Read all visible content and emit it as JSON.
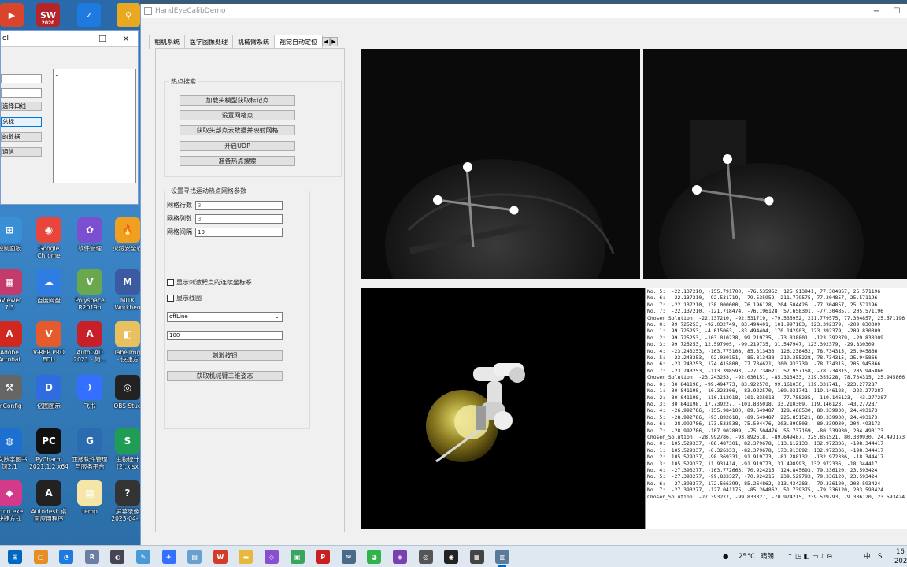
{
  "top_icons": [
    {
      "name": "media-icon",
      "glyph": "▶",
      "color": "#d9452c"
    },
    {
      "name": "solidworks-icon",
      "glyph": "SW",
      "sub": "2020",
      "color": "#b3252a"
    },
    {
      "name": "shield-icon",
      "glyph": "✓",
      "color": "#1f7ae0"
    },
    {
      "name": "search-icon",
      "glyph": "⚲",
      "color": "#e8a820"
    }
  ],
  "small_window": {
    "title": "ol",
    "btn_labels": [
      "选择口线",
      "总标",
      "的数据",
      "通信"
    ],
    "text_value": "1"
  },
  "desktop_icons": [
    {
      "name": "control-panel-icon",
      "label": "控制面板",
      "glyph": "⊞",
      "color": "#3a8fd6"
    },
    {
      "name": "google-chrome-icon",
      "label": "Google\nChrome",
      "glyph": "◉",
      "color": "#e8453c"
    },
    {
      "name": "software-manager-icon",
      "label": "软件管理",
      "glyph": "✿",
      "color": "#7b4fd0"
    },
    {
      "name": "huorong-icon",
      "label": "火绒安全软",
      "glyph": "🔥",
      "color": "#f0a020"
    },
    {
      "name": "gaviewer-icon",
      "label": "aViewer\n7.3",
      "glyph": "▦",
      "color": "#c23b6b"
    },
    {
      "name": "baidu-netdisk-icon",
      "label": "百度网盘",
      "glyph": "☁",
      "color": "#2f7ce3"
    },
    {
      "name": "polyspace-icon",
      "label": "Polyspace\nR2019b",
      "glyph": "V",
      "color": "#6aa84f"
    },
    {
      "name": "mitk-icon",
      "label": "MITK\nWorkben",
      "glyph": "M",
      "color": "#3b5aa0"
    },
    {
      "name": "adobe-acrobat-icon",
      "label": "Adobe\nAcrobat",
      "glyph": "A",
      "color": "#d0281e"
    },
    {
      "name": "vrep-icon",
      "label": "V-REP PRO\nEDU",
      "glyph": "V",
      "color": "#e55b2c"
    },
    {
      "name": "autocad-icon",
      "label": "AutoCAD\n2021 - 简...",
      "glyph": "A",
      "color": "#c8202a"
    },
    {
      "name": "labelimg-icon",
      "label": "labelImg\n- 快捷方",
      "glyph": "◧",
      "color": "#e8c060"
    },
    {
      "name": "cmconfig-icon",
      "label": "mConfig",
      "glyph": "⚒",
      "color": "#666"
    },
    {
      "name": "yitu-icon",
      "label": "亿图图示",
      "glyph": "D",
      "color": "#2f6ce0"
    },
    {
      "name": "feishu-icon",
      "label": "飞书",
      "glyph": "✈",
      "color": "#3370ff"
    },
    {
      "name": "obs-icon",
      "label": "OBS Stud",
      "glyph": "◎",
      "color": "#222"
    },
    {
      "name": "library-icon",
      "label": "图文数字图书\n馆2.1",
      "glyph": "◍",
      "color": "#1d6fd0"
    },
    {
      "name": "pycharm-icon",
      "label": "PyCharm\n2021.1.2 x64",
      "glyph": "PC",
      "color": "#111"
    },
    {
      "name": "cert-assistant-icon",
      "label": "正版软件管理\n与服务平台",
      "glyph": "G",
      "color": "#2b6cb0"
    },
    {
      "name": "excel-file-icon",
      "label": "生物统计\n(2).xlsx",
      "glyph": "S",
      "color": "#1f9d55"
    },
    {
      "name": "micronexe-icon",
      "label": "icron.exe\n快捷方式",
      "glyph": "◆",
      "color": "#d43a8a"
    },
    {
      "name": "autodesk-app-icon",
      "label": "Autodesk 桌\n面应用程序",
      "glyph": "A",
      "color": "#222"
    },
    {
      "name": "temp-folder-icon",
      "label": "temp",
      "glyph": "▤",
      "color": "#f5e6a8"
    },
    {
      "name": "recording-icon",
      "label": "屏幕录像\n2023-04-...",
      "glyph": "?",
      "color": "#333"
    }
  ],
  "main_window": {
    "title": "HandEyeCalibDemo",
    "tabs": [
      "相机系统",
      "医学图像处理",
      "机械臂系统",
      "视觉自动定位"
    ],
    "active_tab": 3,
    "group1": {
      "title": "热点搜索",
      "buttons": [
        "加载头模型获取标记点",
        "设置网格点",
        "获取头部点云数据并映射网格",
        "开启UDP",
        "准备热点搜索"
      ]
    },
    "group2": {
      "title": "设置寻找运动热点网格参数",
      "fields": [
        {
          "label": "网格行数",
          "value": "3"
        },
        {
          "label": "网格列数",
          "value": "3"
        },
        {
          "label": "网格间隔",
          "value": "10"
        }
      ],
      "checkboxes": [
        "显示刺激靶点的连续坐标系",
        "显示线圈"
      ],
      "combo_value": "offLine",
      "input_value": "100",
      "buttons": [
        "刺激按钮",
        "获取机械臂三维姿态"
      ]
    },
    "log_lines": [
      "No. 5:  -22.137210, -155.791700, -76.535952, 125.913941, 77.304857, 25.571196",
      "No. 6:  -22.137210, -92.531719, -79.535952, 211.779575, 77.304857, 25.571196",
      "No. 7:  -22.137210, 138.000000, 76.196128, 204.504426, -77.304857, 25.571196",
      "No. 7:  -22.137210, -121.718474, -76.196128, 57.658301, -77.304857, 205.571196",
      "Chosen_Solution: -22.137210, -92.531719, -79.535952, 211.779575, 77.304857, 25.571196",
      "No. 0:  99.725253, -92.032749, 83.494401, 101.997183, 123.392379, -209.830309",
      "No. 1:  99.725253, -4.015063, -83.494404, 170.142903, 123.392379, -209.830309",
      "No. 2:  99.725253, -103.010238, 99.219735, -73.838801, -123.392379, -29.830309",
      "No. 3:  99.725253, 12.597905, -99.219735, 31.547947, 123.392379, -29.830309",
      "No. 4:  -23.243253, -163.775108, 85.313433, 126.238452, 78.734315, 25.945866",
      "No. 5:  -23.243253, -92.030151, -85.313433, 219.355228, 78.734315, 25.945866",
      "No. 6:  -23.243253, 174.415800, 77.734621, 300.933739, -78.734315, 205.945866",
      "No. 7:  -23.243253, -113.398593, -77.734621, 52.957158, -78.734315, 205.945866",
      "Chosen_Solution: -23.243253, -92.030151, -85.313433, 219.355228, 78.734315, 25.945866",
      "No. 0:  30.841198, -99.494773, 83.922570, 99.161030, 119.331741, -223.277287",
      "No. 1:  30.841198, -10.323306, -83.922570, 169.031741, 119.146123, -223.277287",
      "No. 2:  30.841198, -110.112918, 101.835018, -77.758235, -119.146123, -43.277287",
      "No. 3:  30.841198, 17.739227, -101.835018, 33.210309, 119.146123, -43.277287",
      "No. 4:  -26.992786, -155.984100, 89.649487, 128.466530, 80.339930, 24.493173",
      "No. 5:  -28.992786, -93.892618, -89.649487, 225.851521, 80.339930, 24.493173",
      "No. 6:  -28.992786, 173.533538, 75.504476, 303.399503, -80.339930, 204.493173",
      "No. 7:  -28.992786, -107.902809, -75.504476, 55.737169, -80.339930, 204.493173",
      "Chosen_Solution: -28.992786, -93.892618, -89.649487, 225.851521, 80.339930, 24.493173",
      "No. 0:  105.529337, -88.487301, 82.379678, 113.112133, 132.972336, -198.344417",
      "No. 1:  105.529337, -0.326333, -82.379678, 173.913892, 132.972336, -198.344417",
      "No. 2:  105.529337, -98.369331, 91.919773, -81.288132, -132.972336, -18.344417",
      "No. 3:  105.529337, 11.931414, -91.919773, 31.498993, 132.972336, -18.344417",
      "No. 4:  -27.393277, -163.772663, 70.924215, 124.845693, 79.336120, 23.593424",
      "No. 5:  -27.393277, -99.833327, -70.924215, 239.529793, 79.336120, 23.593424",
      "No. 6:  -27.393277, 172.566399, 85.264862, 313.434283, -79.336120, 203.593424",
      "No. 7:  -27.393277, -127.041175, -85.264862, 51.739375, -79.336120, 203.593424",
      "Chosen_Solution: -27.393277, -99.833327, -70.924215, 239.529793, 79.336120, 23.593424"
    ]
  },
  "taskbar": {
    "apps": [
      {
        "name": "windows-start-icon",
        "glyph": "⊞",
        "color": "#0067c0"
      },
      {
        "name": "file-manager-icon",
        "glyph": "▢",
        "color": "#e58e26"
      },
      {
        "name": "search-app-icon",
        "glyph": "◔",
        "color": "#1f7ae0"
      },
      {
        "name": "r-app-icon",
        "glyph": "R",
        "color": "#6b7fa5"
      },
      {
        "name": "browser-icon",
        "glyph": "◐",
        "color": "#445"
      },
      {
        "name": "paint-icon",
        "glyph": "✎",
        "color": "#4b9ad6"
      },
      {
        "name": "feishu-task-icon",
        "glyph": "✈",
        "color": "#3370ff"
      },
      {
        "name": "notes-icon",
        "glyph": "▤",
        "color": "#6aa0d0"
      },
      {
        "name": "wps-icon",
        "glyph": "W",
        "color": "#d23b2a"
      },
      {
        "name": "folder-icon",
        "glyph": "▬",
        "color": "#e8b83a"
      },
      {
        "name": "visual-studio-icon",
        "glyph": "◇",
        "color": "#8a4ed0"
      },
      {
        "name": "chat-icon",
        "glyph": "▣",
        "color": "#3aa55c"
      },
      {
        "name": "pdf-icon",
        "glyph": "P",
        "color": "#c82020"
      },
      {
        "name": "message-icon",
        "glyph": "✉",
        "color": "#4a6a8a"
      },
      {
        "name": "wechat-icon",
        "glyph": "◕",
        "color": "#2fb34a"
      },
      {
        "name": "vs-code-icon",
        "glyph": "◈",
        "color": "#7a3fb0"
      },
      {
        "name": "steam-icon",
        "glyph": "◎",
        "color": "#555"
      },
      {
        "name": "obs-task-icon",
        "glyph": "◉",
        "color": "#222"
      },
      {
        "name": "terminal-icon",
        "glyph": "▦",
        "color": "#444"
      },
      {
        "name": "demo-app-icon",
        "glyph": "▥",
        "color": "#5a7a9a"
      }
    ],
    "weather_temp": "25°C",
    "weather_text": "晴朗",
    "ime": "中",
    "time": "16",
    "date": "202"
  }
}
